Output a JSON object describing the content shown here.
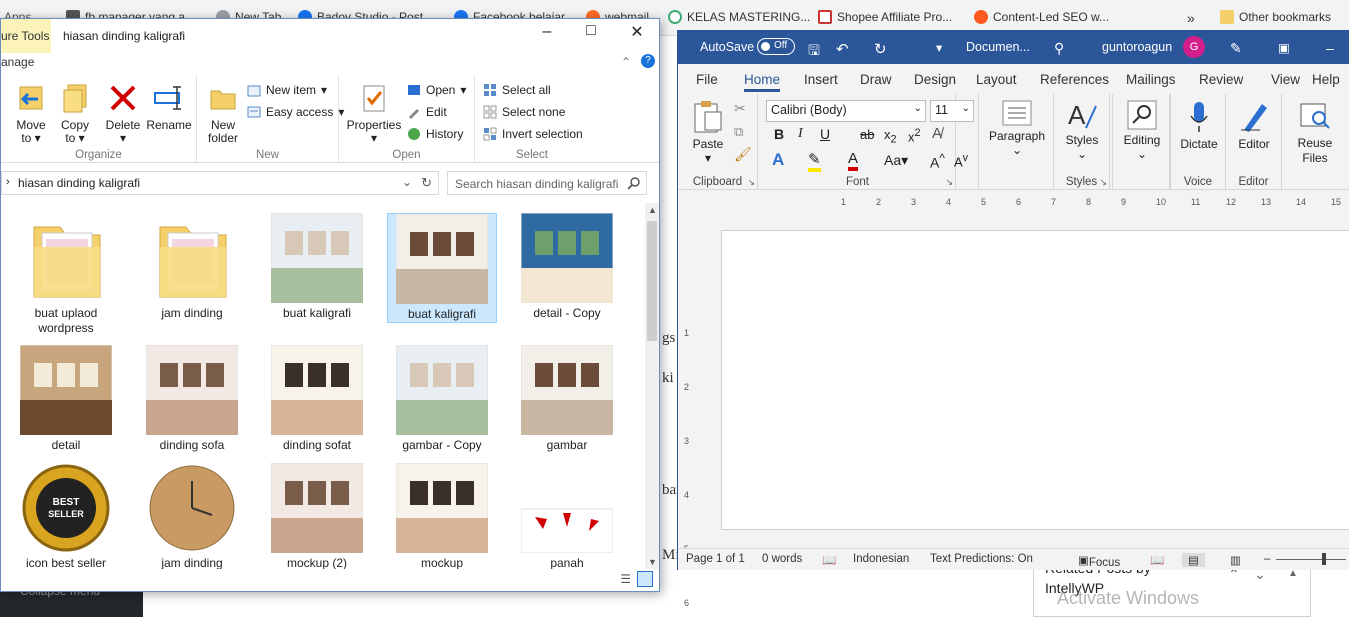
{
  "bookmarks": [
    "Apps",
    "fb manager yang a...",
    "New Tab",
    "Badoy Studio - Post",
    "Facebook belajar",
    "webmail",
    "KELAS MASTERING...",
    "Shopee Affiliate Pro...",
    "Content-Led SEO w...",
    "»",
    "Other bookmarks"
  ],
  "explorer": {
    "context_tab": "ure Tools",
    "context_sub": "anage",
    "title": "hiasan dinding kaligrafi",
    "ribbon": {
      "organize": {
        "label": "Organize",
        "move": "Move to",
        "copy": "Copy to",
        "delete": "Delete",
        "rename": "Rename"
      },
      "new": {
        "label": "New",
        "new_folder": "New folder",
        "new_item": "New item",
        "easy_access": "Easy access"
      },
      "open": {
        "label": "Open",
        "properties": "Properties",
        "open": "Open",
        "edit": "Edit",
        "history": "History"
      },
      "select": {
        "label": "Select",
        "select_all": "Select all",
        "select_none": "Select none",
        "invert": "Invert selection"
      }
    },
    "address": "hiasan dinding kaligrafi",
    "search_placeholder": "Search hiasan dinding kaligrafi",
    "files": [
      {
        "name": "buat uplaod wordpress",
        "type": "folder"
      },
      {
        "name": "jam dinding",
        "type": "folder"
      },
      {
        "name": "buat kaligrafi",
        "type": "image"
      },
      {
        "name": "buat kaligrafi",
        "type": "image",
        "selected": true
      },
      {
        "name": "detail - Copy",
        "type": "image"
      },
      {
        "name": "detail",
        "type": "image"
      },
      {
        "name": "dinding sofa",
        "type": "image"
      },
      {
        "name": "dinding sofat",
        "type": "image"
      },
      {
        "name": "gambar - Copy",
        "type": "image"
      },
      {
        "name": "gambar",
        "type": "image"
      },
      {
        "name": "icon best seller",
        "type": "image"
      },
      {
        "name": "jam dinding",
        "type": "image"
      },
      {
        "name": "mockup (2)",
        "type": "image"
      },
      {
        "name": "mockup",
        "type": "image"
      },
      {
        "name": "panah",
        "type": "image"
      }
    ],
    "badge_best": "BEST SELLER",
    "collapse": "Collapse menu"
  },
  "word": {
    "autosave": "AutoSave",
    "toggle": "Off",
    "doc": "Documen...",
    "user": "guntoroagun",
    "avatar": "G",
    "tabs": [
      "File",
      "Home",
      "Insert",
      "Draw",
      "Design",
      "Layout",
      "References",
      "Mailings",
      "Review",
      "View",
      "Help"
    ],
    "active_tab": "Home",
    "clipboard": {
      "label": "Clipboard",
      "paste": "Paste"
    },
    "font": {
      "label": "Font",
      "name": "Calibri (Body)",
      "size": "11"
    },
    "paragraph": "Paragraph",
    "styles": {
      "label": "Styles",
      "btn": "Styles"
    },
    "editing": "Editing",
    "voice": {
      "label": "Voice",
      "btn": "Dictate"
    },
    "editor": {
      "label": "Editor",
      "btn": "Editor"
    },
    "reuse": {
      "label": "Reuse Files",
      "btn": "Reuse Files"
    },
    "status": {
      "page": "Page 1 of 1",
      "words": "0 words",
      "lang": "Indonesian",
      "pred": "Text Predictions: On",
      "focus": "Focus"
    }
  },
  "background": {
    "related": "Related Posts by",
    "intelly": "IntellyWP",
    "activate": "Activate Windows"
  },
  "colors": {
    "word_blue": "#2b579a",
    "selection": "#cce8ff",
    "delete_red": "#d00000",
    "folder": "#f5d06a"
  }
}
